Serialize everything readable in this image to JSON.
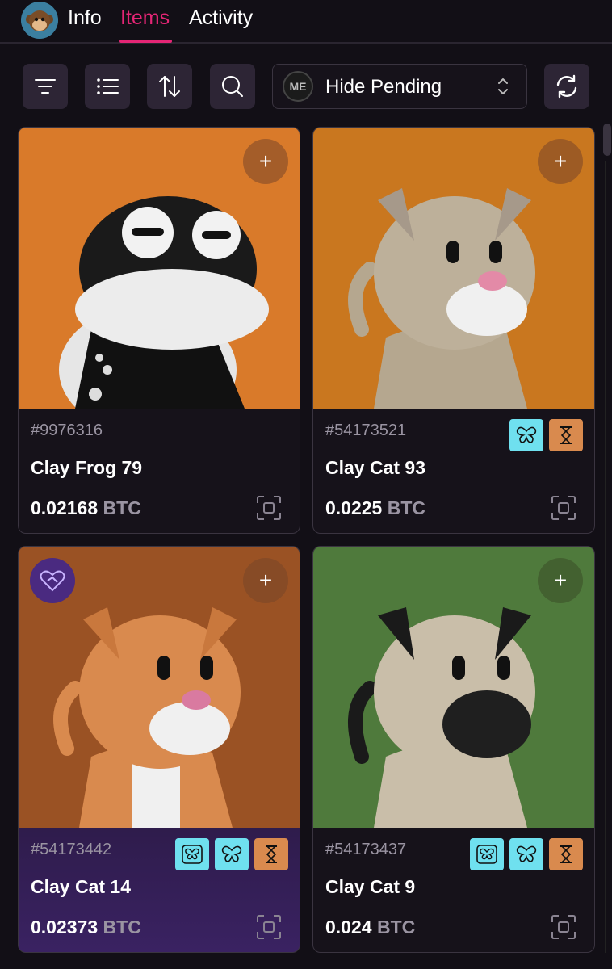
{
  "nav": {
    "tabs": [
      {
        "label": "Info"
      },
      {
        "label": "Items"
      },
      {
        "label": "Activity"
      }
    ],
    "active_tab": "Items"
  },
  "toolbar": {
    "buttons": [
      "filter-icon",
      "list-icon",
      "sort-icon",
      "search-icon"
    ],
    "pending_filter": {
      "label": "Hide Pending",
      "logo_text": "ME"
    },
    "refresh": "refresh-icon"
  },
  "items": [
    {
      "id": "#9976316",
      "name": "Clay Frog 79",
      "price": "0.02168",
      "currency": "BTC",
      "badges": [],
      "bg": "#d97a2a",
      "animal": "frog"
    },
    {
      "id": "#54173521",
      "name": "Clay Cat 93",
      "price": "0.0225",
      "currency": "BTC",
      "badges": [
        "butterfly-icon",
        "hourglass-icon"
      ],
      "bg": "#c9771f",
      "animal": "cat-beige"
    },
    {
      "id": "#54173442",
      "name": "Clay Cat 14",
      "price": "0.02373",
      "currency": "BTC",
      "badges": [
        "butterfly-outline-icon",
        "butterfly-icon",
        "hourglass-icon"
      ],
      "bg": "#9a5224",
      "animal": "cat-orange",
      "selected": true
    },
    {
      "id": "#54173437",
      "name": "Clay Cat 9",
      "price": "0.024",
      "currency": "BTC",
      "badges": [
        "butterfly-outline-icon",
        "butterfly-icon",
        "hourglass-icon"
      ],
      "bg": "#4f7a3c",
      "animal": "cat-siamese"
    }
  ],
  "colors": {
    "accent": "#e42575",
    "badge_cyan": "#6fe0ef",
    "badge_orange": "#d98a4e"
  }
}
